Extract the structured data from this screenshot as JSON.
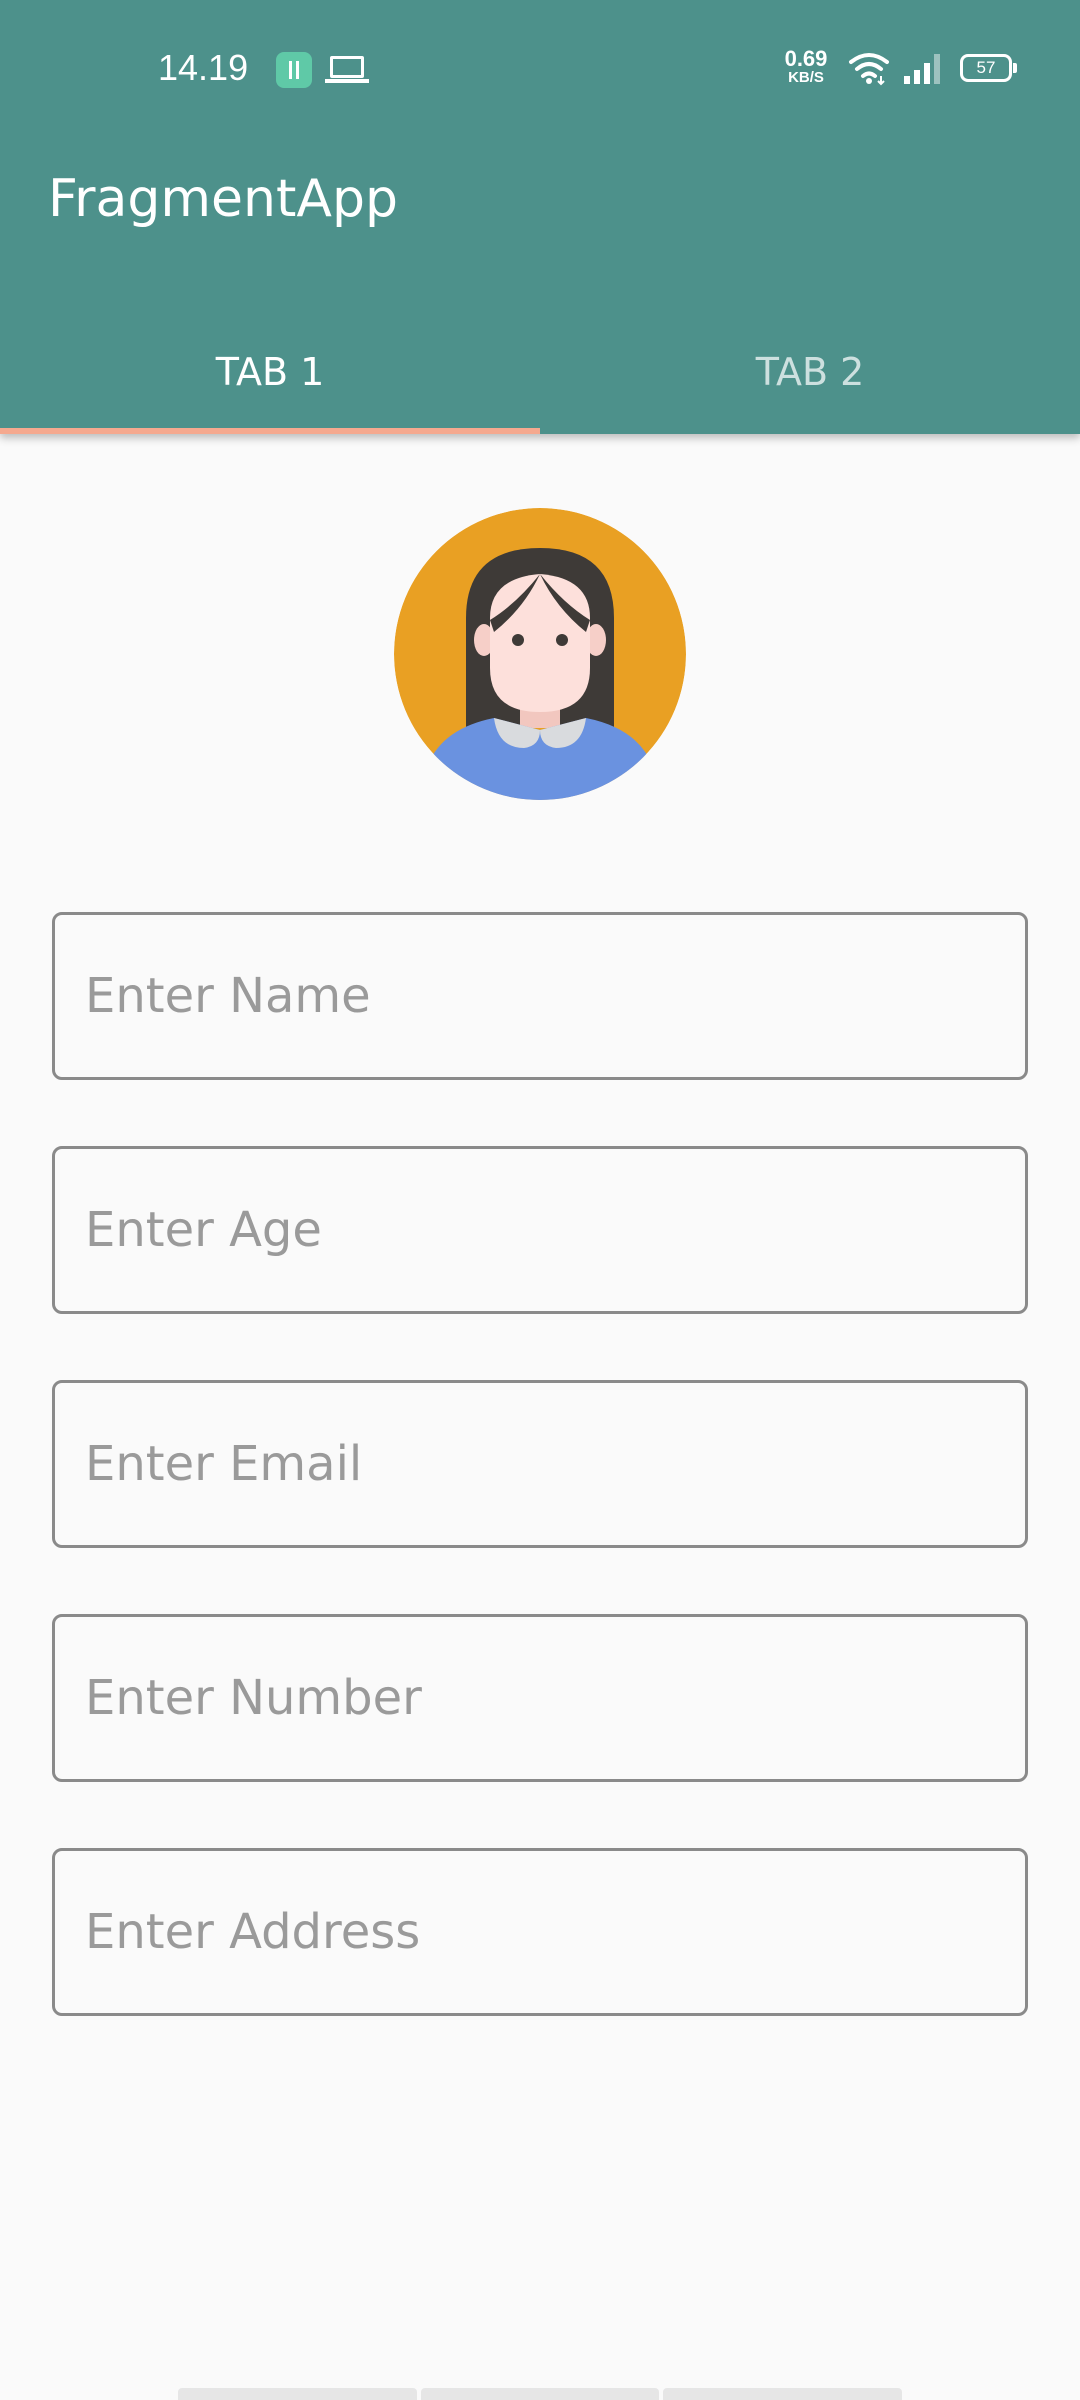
{
  "status_bar": {
    "time": "14.19",
    "net_speed_value": "0.69",
    "net_speed_unit": "KB/S",
    "battery": "57",
    "icons": [
      "notification-app-icon",
      "laptop-icon",
      "wifi-icon",
      "signal-icon",
      "battery-icon"
    ]
  },
  "app_bar": {
    "title": "FragmentApp",
    "color": "#4d918b"
  },
  "tabs": [
    {
      "label": "TAB 1",
      "selected": true
    },
    {
      "label": "TAB 2",
      "selected": false
    }
  ],
  "tab_indicator_color": "#f5a98f",
  "avatar": {
    "icon": "woman-avatar-icon",
    "background_color": "#e9a023",
    "shirt_color": "#6a92e0"
  },
  "form": {
    "name_placeholder": "Enter Name",
    "age_placeholder": "Enter Age",
    "email_placeholder": "Enter Email",
    "number_placeholder": "Enter Number",
    "address_placeholder": "Enter Address"
  }
}
